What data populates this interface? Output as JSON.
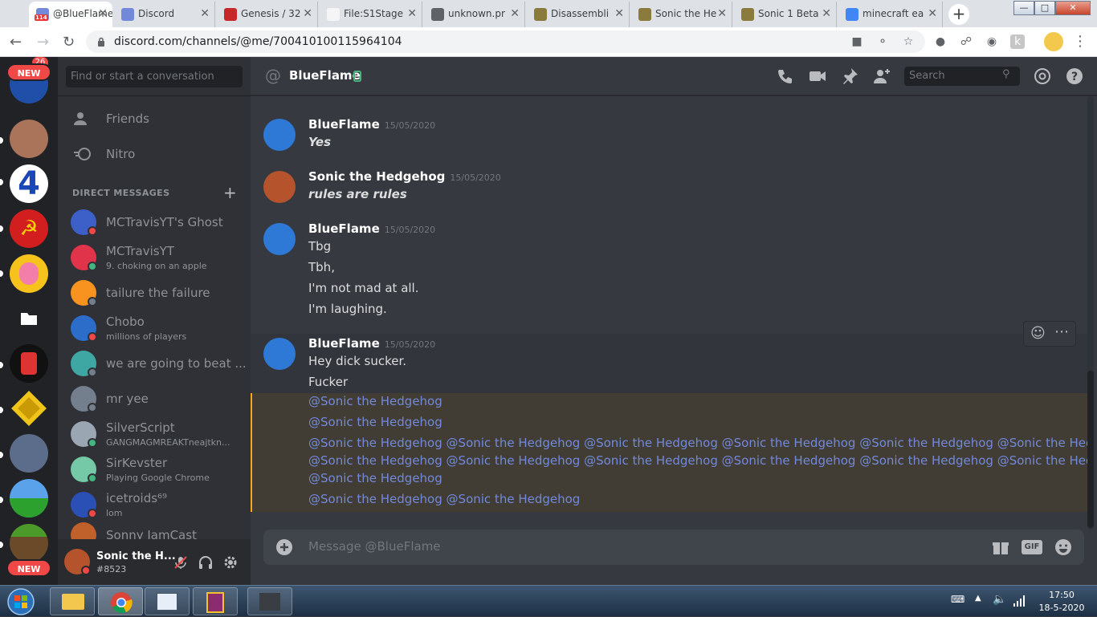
{
  "browser": {
    "tabs": [
      {
        "label": "@BlueFlame",
        "active": true,
        "fav_color": "#7289da",
        "badge": "114"
      },
      {
        "label": "Discord",
        "active": false,
        "fav_color": "#7289da"
      },
      {
        "label": "Genesis / 32",
        "active": false,
        "fav_color": "#c62828"
      },
      {
        "label": "File:S1Stage",
        "active": false,
        "fav_color": "#f5f5f5"
      },
      {
        "label": "unknown.pr",
        "active": false,
        "fav_color": "#5f6368"
      },
      {
        "label": "Disassembli",
        "active": false,
        "fav_color": "#8a7a3c"
      },
      {
        "label": "Sonic the He",
        "active": false,
        "fav_color": "#8a7a3c"
      },
      {
        "label": "Sonic 1 Beta",
        "active": false,
        "fav_color": "#8a7a3c"
      },
      {
        "label": "minecraft ea",
        "active": false,
        "fav_color": "#4285f4"
      }
    ],
    "new_tab": "+",
    "url": "discord.com/channels/@me/700410100115964104"
  },
  "servers": {
    "top_badge": "26",
    "new_label": "NEW",
    "bottom_new_label": "NEW",
    "folder_icon": "folder-icon"
  },
  "dm_sidebar": {
    "search_placeholder": "Find or start a conversation",
    "friends_label": "Friends",
    "nitro_label": "Nitro",
    "direct_messages_label": "DIRECT MESSAGES",
    "add_dm": "+",
    "dms": [
      {
        "name": "MCTravisYT's Ghost",
        "sub": "",
        "status": "#f04747",
        "avatar": "#3c5fc8"
      },
      {
        "name": "MCTravisYT",
        "sub": "9. choking on an apple",
        "status": "#43b581",
        "avatar": "#e0344a"
      },
      {
        "name": "tailure the failure",
        "sub": "",
        "status": "#747f8d",
        "avatar": "#f7931e"
      },
      {
        "name": "Chobo",
        "sub": "millions of players",
        "status": "#f04747",
        "avatar": "#2b6dc9"
      },
      {
        "name": "we are going to beat ...",
        "sub": "",
        "status": "#747f8d",
        "avatar": "#3fa7a3"
      },
      {
        "name": "mr yee",
        "sub": "",
        "status": "#747f8d",
        "avatar": "#747f8d"
      },
      {
        "name": "SilverScript",
        "sub": "GANGMAGMREAKTneajtkn...",
        "status": "#43b581",
        "avatar": "#9aa6b2"
      },
      {
        "name": "SirKevster",
        "sub": "Playing Google Chrome",
        "status": "#43b581",
        "avatar": "#75c9a7"
      },
      {
        "name": "icetroids⁶⁹",
        "sub": "lom",
        "status": "#f04747",
        "avatar": "#2a4fb5"
      },
      {
        "name": "Sonny JamCast",
        "sub": "",
        "status": "#747f8d",
        "avatar": "#c0602a"
      }
    ],
    "user": {
      "name": "Sonic the H...",
      "tag": "#8523"
    }
  },
  "chat": {
    "recipient": "BlueFlame",
    "search_placeholder": "Search",
    "messages": [
      {
        "author": "BlueFlame",
        "time": "15/05/2020",
        "lines": [
          "Yes"
        ],
        "style": "em"
      },
      {
        "author": "Sonic the Hedgehog",
        "time": "15/05/2020",
        "lines": [
          "rules are rules"
        ],
        "style": "em"
      },
      {
        "author": "BlueFlame",
        "time": "15/05/2020",
        "lines": [
          "Tbg",
          "Tbh,",
          "I'm not mad at all.",
          "I'm laughing."
        ],
        "style": "normal"
      },
      {
        "author": "BlueFlame",
        "time": "15/05/2020",
        "lines": [
          "Hey dick sucker.",
          "Fucker"
        ],
        "style": "normal"
      }
    ],
    "mention_text": "@Sonic the Hedgehog",
    "mention_lines": [
      [
        "@Sonic the Hedgehog"
      ],
      [
        "@Sonic the Hedgehog"
      ],
      [
        "@Sonic the Hedgehog",
        "@Sonic the Hedgehog",
        "@Sonic the Hedgehog",
        "@Sonic the Hedgehog",
        "@Sonic the Hedgehog",
        "@Sonic the Hedgehog"
      ],
      [
        "@Sonic the Hedgehog",
        "@Sonic the Hedgehog",
        "@Sonic the Hedgehog",
        "@Sonic the Hedgehog",
        "@Sonic the Hedgehog",
        "@Sonic the Hedgehog"
      ],
      [
        "@Sonic the Hedgehog"
      ],
      [
        "@Sonic the Hedgehog",
        "@Sonic the Hedgehog"
      ]
    ],
    "composer_placeholder": "Message @BlueFlame",
    "gif_label": "GIF"
  },
  "taskbar": {
    "time": "17:50",
    "date": "18-5-2020"
  },
  "colors": {
    "accent": "#7289da",
    "mention_highlight": "#faa61a",
    "online": "#43b581",
    "dnd": "#f04747"
  }
}
